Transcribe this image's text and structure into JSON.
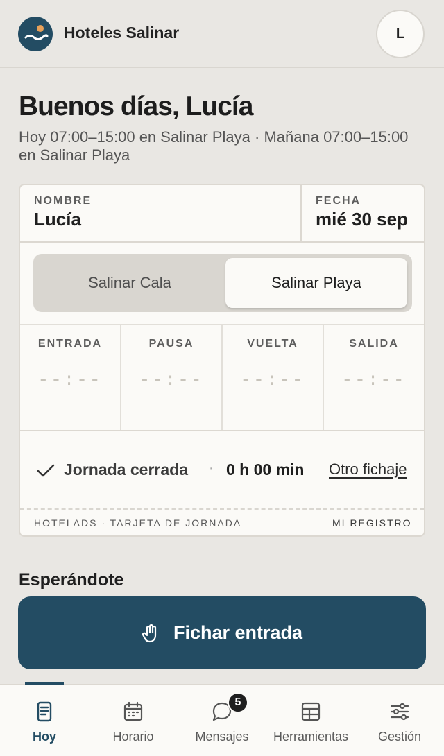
{
  "header": {
    "brand": "Hoteles Salinar",
    "avatar_initial": "L"
  },
  "greeting": "Buenos días, Lucía",
  "shift_info": "Hoy 07:00–15:00 en Salinar Playa · Mañana 07:00–15:00 en Salinar Playa",
  "card": {
    "name_label": "NOMBRE",
    "name_value": "Lucía",
    "date_label": "FECHA",
    "date_value": "mié 30 sep",
    "locations": [
      {
        "label": "Salinar Cala",
        "selected": false
      },
      {
        "label": "Salinar Playa",
        "selected": true
      }
    ],
    "times": [
      {
        "label": "ENTRADA",
        "value": "--:--"
      },
      {
        "label": "PAUSA",
        "value": "--:--"
      },
      {
        "label": "VUELTA",
        "value": "--:--"
      },
      {
        "label": "SALIDA",
        "value": "--:--"
      }
    ],
    "status": "Jornada cerrada",
    "separator": "·",
    "duration": "0 h 00 min",
    "other_link": "Otro fichaje",
    "footer_left": "HOTELADS · TARJETA DE JORNADA",
    "footer_right": "MI REGISTRO"
  },
  "waiting_title": "Esperándote",
  "cta": {
    "label": "Fichar entrada",
    "icon": "hand-icon"
  },
  "nav": {
    "items": [
      {
        "label": "Hoy",
        "icon": "document-icon",
        "active": true
      },
      {
        "label": "Horario",
        "icon": "calendar-icon",
        "active": false
      },
      {
        "label": "Mensajes",
        "icon": "chat-icon",
        "active": false,
        "badge": "5"
      },
      {
        "label": "Herramientas",
        "icon": "grid-icon",
        "active": false
      },
      {
        "label": "Gestión",
        "icon": "sliders-icon",
        "active": false
      }
    ]
  },
  "colors": {
    "background": "#e9e7e3",
    "primary": "#234c63",
    "card": "#fbfaf7",
    "accent_sun": "#e8a15a"
  }
}
